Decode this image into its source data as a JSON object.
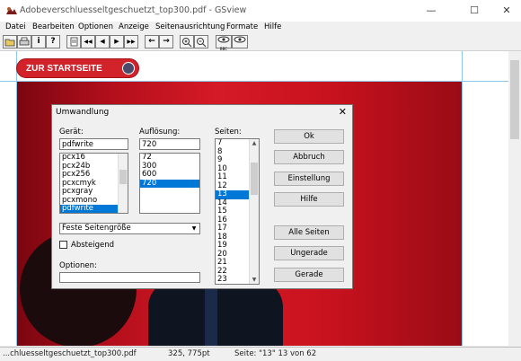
{
  "window": {
    "title": "Adobeverschluesseltgeschuetzt_top300.pdf - GSview"
  },
  "titlebar_buttons": {
    "minimize": "—",
    "maximize": "☐",
    "close": "✕"
  },
  "menu": [
    "Datei",
    "Bearbeiten",
    "Optionen",
    "Anzeige",
    "Seitenausrichtung",
    "Formate",
    "Hilfe"
  ],
  "toolbar": {
    "open": "open-icon",
    "print": "print-icon",
    "info": "i",
    "help": "?",
    "goto": "goto-page-icon",
    "first": "◀◀",
    "prev": "◀",
    "next": "▶",
    "last": "▶▶",
    "back": "←",
    "forward": "→",
    "zoom_in": "zoom-in-icon",
    "zoom_out": "zoom-out-icon",
    "view_1": "eye-icon",
    "view_2": "eye-icon",
    "view_label": "BBC"
  },
  "document": {
    "start_button": "ZUR STARTSEITE"
  },
  "dialog": {
    "title": "Umwandlung",
    "close": "✕",
    "device": {
      "label": "Gerät:",
      "value": "pdfwrite",
      "items": [
        "pcx16",
        "pcx24b",
        "pcx256",
        "pcxcmyk",
        "pcxgray",
        "pcxmono",
        "pdfwrite"
      ],
      "selected": "pdfwrite"
    },
    "resolution": {
      "label": "Auflösung:",
      "value": "720",
      "items": [
        "72",
        "300",
        "600",
        "720"
      ],
      "selected": "720"
    },
    "pages": {
      "label": "Seiten:",
      "items": [
        "7",
        "8",
        "9",
        "10",
        "11",
        "12",
        "13",
        "14",
        "15",
        "16",
        "17",
        "18",
        "19",
        "20",
        "21",
        "22",
        "23"
      ],
      "selected": "13"
    },
    "page_size": "Feste Seitengröße",
    "ascending_label": "Absteigend",
    "options_label": "Optionen:",
    "options_value": "",
    "buttons": {
      "ok": "Ok",
      "cancel": "Abbruch",
      "settings": "Einstellung",
      "help": "Hilfe",
      "all_pages": "Alle Seiten",
      "odd": "Ungerade",
      "even": "Gerade"
    }
  },
  "status": {
    "file": "...chluesseltgeschuetzt_top300.pdf",
    "coords": "325, 775pt",
    "page": "Seite: \"13\"  13 von 62"
  }
}
